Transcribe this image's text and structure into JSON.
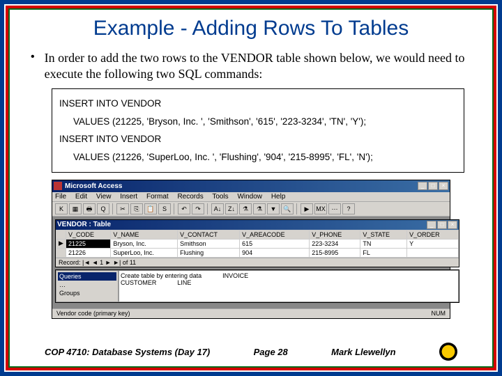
{
  "slide": {
    "title": "Example - Adding Rows To Tables",
    "bullet": "•",
    "body": "In order to add the two rows to the VENDOR table shown below, we would need to execute the following two SQL commands:",
    "sql1_line1": "INSERT INTO VENDOR",
    "sql1_line2": "VALUES (21225, 'Bryson, Inc. ', 'Smithson', '615', '223-3234', 'TN', 'Y');",
    "sql2_line1": "INSERT INTO VENDOR",
    "sql2_line2": "VALUES (21226, 'SuperLoo, Inc. ', 'Flushing', '904', '215-8995', 'FL', 'N');"
  },
  "access": {
    "app_title": "Microsoft Access",
    "menus": [
      "File",
      "Edit",
      "View",
      "Insert",
      "Format",
      "Records",
      "Tools",
      "Window",
      "Help"
    ],
    "toolbar_icons": [
      "K",
      "▦",
      "🖶",
      "Q",
      "✂",
      "⎘",
      "📋",
      "S",
      "↶",
      "↷",
      "A↓",
      "Z↓",
      "⚗",
      "⚗",
      "▼",
      "🔍",
      "▶",
      "MX",
      "⋯",
      "?"
    ],
    "table_window_title": "VENDOR : Table",
    "columns": [
      "V_CODE",
      "V_NAME",
      "V_CONTACT",
      "V_AREACODE",
      "V_PHONE",
      "V_STATE",
      "V_ORDER"
    ],
    "rows": [
      {
        "marker": "▶",
        "V_CODE": "21225",
        "V_NAME": "Bryson, Inc.",
        "V_CONTACT": "Smithson",
        "V_AREACODE": "615",
        "V_PHONE": "223-3234",
        "V_STATE": "TN",
        "V_ORDER": "Y"
      },
      {
        "marker": "",
        "V_CODE": "21226",
        "V_NAME": "SuperLoo, Inc.",
        "V_CONTACT": "Flushing",
        "V_AREACODE": "904",
        "V_PHONE": "215-8995",
        "V_STATE": "FL",
        "V_ORDER": ""
      }
    ],
    "record_nav": "Record: |◄  ◄  1  ►  ►|  of  11",
    "db_side_items": [
      "Queries",
      "…",
      "Groups"
    ],
    "db_main_items": [
      "Create table by entering data",
      "CUSTOMER",
      "INVOICE",
      "LINE"
    ],
    "status_left": "Vendor code (primary key)",
    "status_right": "NUM"
  },
  "footer": {
    "course": "COP 4710: Database Systems (Day 17)",
    "page": "Page 28",
    "author": "Mark Llewellyn"
  }
}
